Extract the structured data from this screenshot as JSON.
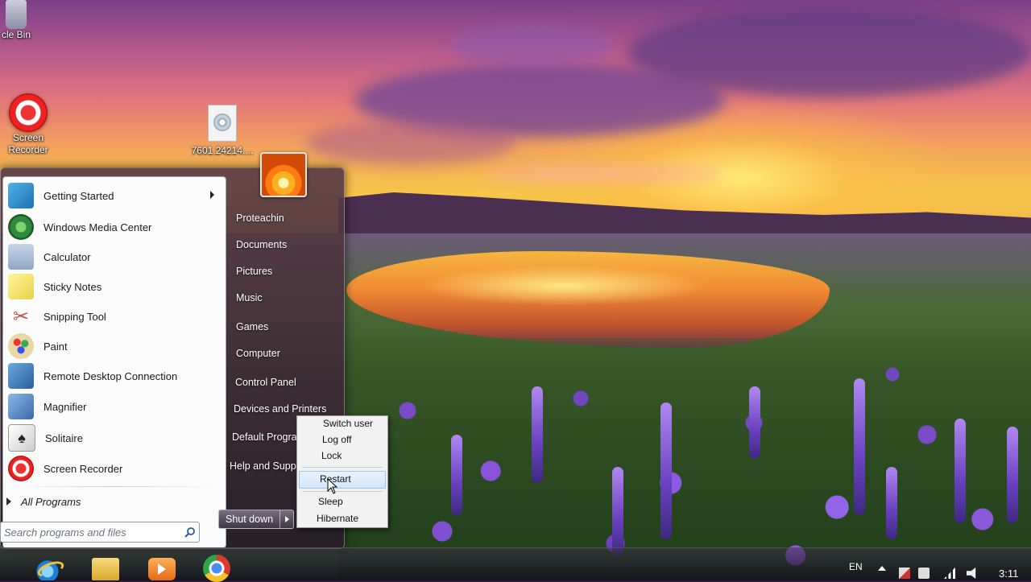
{
  "desktop": {
    "icons": [
      {
        "label": "cle Bin",
        "icon": "recycle-bin-icon"
      },
      {
        "label": "Screen Recorder",
        "icon": "screen-recorder-icon"
      },
      {
        "label": "7601.24214....",
        "icon": "disc-image-file-icon"
      }
    ]
  },
  "start_menu": {
    "programs": [
      {
        "label": "Getting Started",
        "icon": "getting-started-icon",
        "has_submenu": true
      },
      {
        "label": "Windows Media Center",
        "icon": "windows-media-center-icon"
      },
      {
        "label": "Calculator",
        "icon": "calculator-icon"
      },
      {
        "label": "Sticky Notes",
        "icon": "sticky-notes-icon"
      },
      {
        "label": "Snipping Tool",
        "icon": "snipping-tool-icon"
      },
      {
        "label": "Paint",
        "icon": "paint-icon"
      },
      {
        "label": "Remote Desktop Connection",
        "icon": "remote-desktop-icon"
      },
      {
        "label": "Magnifier",
        "icon": "magnifier-icon"
      },
      {
        "label": "Solitaire",
        "icon": "solitaire-icon"
      },
      {
        "label": "Screen Recorder",
        "icon": "screen-recorder-icon"
      }
    ],
    "all_programs": "All Programs",
    "search_placeholder": "Search programs and files",
    "right_items": [
      "Proteachin",
      "Documents",
      "Pictures",
      "Music",
      "Games",
      "Computer",
      "Control Panel",
      "Devices and Printers",
      "Default Program",
      "Help and Suppor"
    ],
    "shutdown_label": "Shut down",
    "shutdown_options": [
      "Switch user",
      "Log off",
      "Lock",
      "Restart",
      "Sleep",
      "Hibernate"
    ],
    "highlighted_option": "Restart"
  },
  "taskbar": {
    "pinned": [
      "internet-explorer-icon",
      "file-explorer-icon",
      "media-player-icon",
      "chrome-icon"
    ],
    "language": "EN",
    "clock": "3:11"
  },
  "colors": {
    "menu_left_bg": "#fbfbfc",
    "submenu_bg": "#f2f2f2",
    "highlight": "#d3e6fa"
  }
}
